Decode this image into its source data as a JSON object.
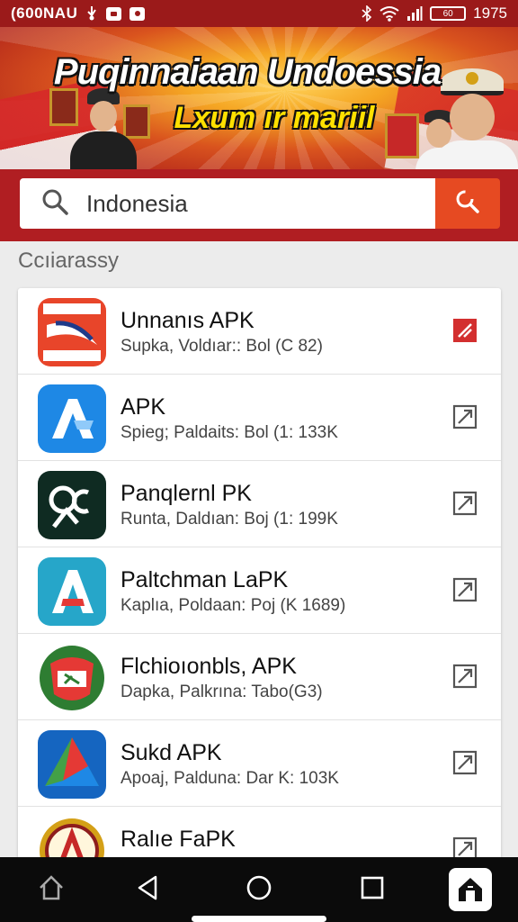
{
  "status_bar": {
    "carrier": "(600NAU",
    "time": "1975",
    "battery_label": "60"
  },
  "banner": {
    "title": "Puqinnaiaan Undoessia",
    "subtitle": "Lxum ır mariil"
  },
  "search": {
    "value": "Indonesia",
    "placeholder": "Indonesia"
  },
  "section_label": "Ccıiarassy",
  "apps": [
    {
      "title": "Unnanıs APK",
      "subtitle": "Supka, Voldıar:: Bol (C 82)",
      "icon": "red-swoosh-app-icon",
      "action": "external-link-icon"
    },
    {
      "title": "APK",
      "subtitle": "Spieg; Paldaits: Bol (1: 133K",
      "icon": "blue-a-app-icon",
      "action": "external-link-icon"
    },
    {
      "title": "Panqlernl PK",
      "subtitle": "Runta, Daldıan: Boj (1: 199K",
      "icon": "dark-green-app-icon",
      "action": "external-link-icon"
    },
    {
      "title": "Paltchman LaPK",
      "subtitle": "Kaplıa, Poldaan: Poj (K 1689)",
      "icon": "teal-a-app-icon",
      "action": "external-link-icon"
    },
    {
      "title": "Flchioıonbls, APK",
      "subtitle": "Dapka, Palkrına: Tabo(G3)",
      "icon": "green-shield-app-icon",
      "action": "external-link-icon"
    },
    {
      "title": "Sukd APK",
      "subtitle": "Apoaj, Palduna: Dar K: 103K",
      "icon": "blue-triangle-app-icon",
      "action": "external-link-icon"
    },
    {
      "title": "Ralıe FaPK",
      "subtitle": "",
      "icon": "gold-emblem-app-icon",
      "action": "external-link-icon"
    }
  ],
  "nav": [
    "home-outline-icon",
    "back-icon",
    "home-circle-icon",
    "recents-icon",
    "launcher-icon"
  ]
}
